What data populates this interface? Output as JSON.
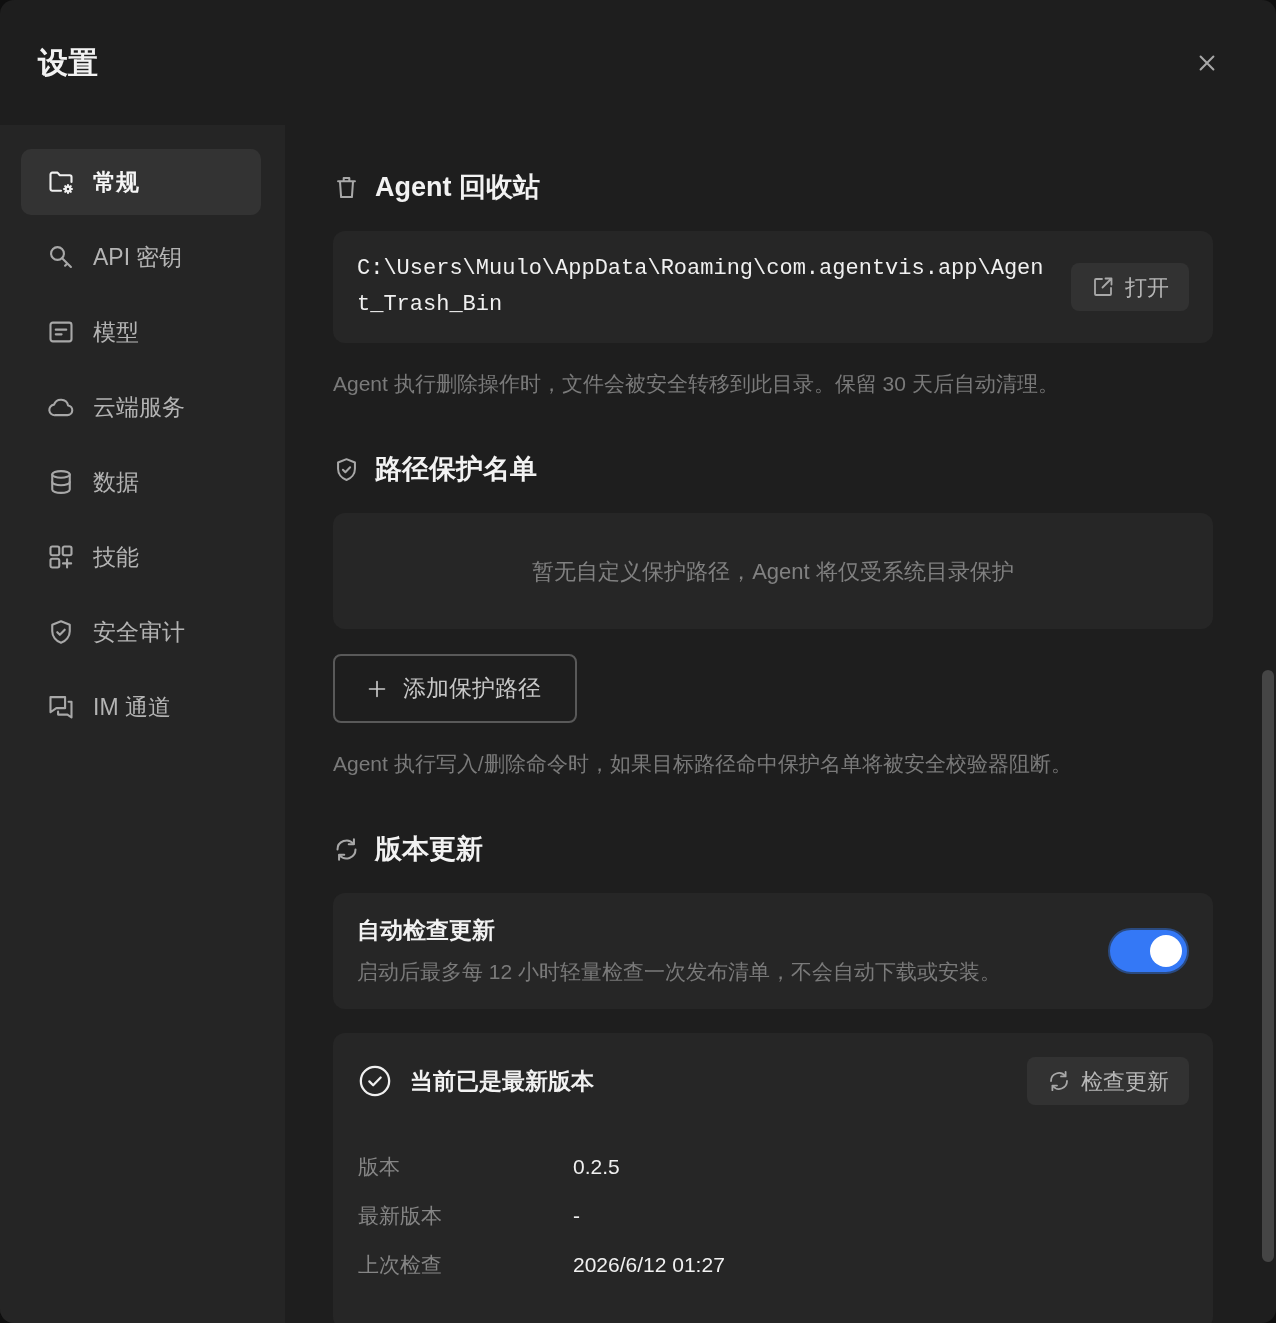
{
  "window": {
    "title": "设置"
  },
  "sidebar": {
    "items": [
      {
        "label": "常规",
        "selected": true
      },
      {
        "label": "API 密钥",
        "selected": false
      },
      {
        "label": "模型",
        "selected": false
      },
      {
        "label": "云端服务",
        "selected": false
      },
      {
        "label": "数据",
        "selected": false
      },
      {
        "label": "技能",
        "selected": false
      },
      {
        "label": "安全审计",
        "selected": false
      },
      {
        "label": "IM 通道",
        "selected": false
      }
    ]
  },
  "sections": [
    {
      "kind": "trash",
      "title": "Agent 回收站",
      "path": "C:\\Users\\Muulo\\AppData\\Roaming\\com.agentvis.app\\Agent_Trash_Bin",
      "button": "打开",
      "note": "Agent 执行删除操作时，文件会被安全转移到此目录。保留 30 天后自动清理。"
    },
    {
      "kind": "protect_list",
      "title": "路径保护名单",
      "empty_text": "暂无自定义保护路径，Agent 将仅受系统目录保护",
      "button": "添加保护路径",
      "note": "Agent 执行写入/删除命令时，如果目标路径命中保护名单将被安全校验器阻断。"
    },
    {
      "kind": "update",
      "title": "版本更新",
      "auto_check": {
        "label": "自动检查更新",
        "description": "启动后最多每 12 小时轻量检查一次发布清单，不会自动下载或安装。",
        "on": true
      },
      "status": {
        "title": "当前已是最新版本",
        "button": "检查更新",
        "rows": [
          {
            "label": "版本",
            "value": "0.2.5"
          },
          {
            "label": "最新版本",
            "value": "-"
          },
          {
            "label": "上次检查",
            "value": "2026/6/12 01:27"
          }
        ]
      }
    }
  ]
}
